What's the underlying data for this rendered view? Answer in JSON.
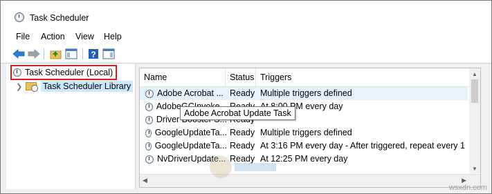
{
  "window": {
    "title": "Task Scheduler"
  },
  "menu": {
    "items": [
      "File",
      "Action",
      "View",
      "Help"
    ]
  },
  "toolbar": {
    "buttons": [
      "back-arrow-icon",
      "forward-arrow-icon",
      "up-folder-icon",
      "show-hide-console-tree-icon",
      "help-icon",
      "show-hide-action-pane-icon"
    ]
  },
  "tree": {
    "root": {
      "label": "Task Scheduler (Local)",
      "highlight_color": "#d32020"
    },
    "child": {
      "label": "Task Scheduler Library",
      "selected": true
    }
  },
  "list": {
    "columns": [
      "Name",
      "Status",
      "Triggers"
    ],
    "rows": [
      {
        "name": "Adobe Acrobat ...",
        "status": "Ready",
        "triggers": "Multiple triggers defined"
      },
      {
        "name": "AdobeGCInvoke...",
        "status": "Ready",
        "triggers": "At 8:00 PM every day"
      },
      {
        "name": "Driver Booster S...",
        "status": "Ready",
        "triggers": ""
      },
      {
        "name": "GoogleUpdateTa...",
        "status": "Ready",
        "triggers": "Multiple triggers defined"
      },
      {
        "name": "GoogleUpdateTa...",
        "status": "Ready",
        "triggers": "At 3:16 PM every day - After triggered, repeat every 1 hou"
      },
      {
        "name": "NvDriverUpdate...",
        "status": "Ready",
        "triggers": "At 12:25 PM every day"
      }
    ]
  },
  "tooltip": {
    "text": "Adobe Acrobat Update Task"
  },
  "watermark": {
    "text": "wsxdn.com"
  },
  "colors": {
    "selection": "#cce8ff",
    "hover_row": "#e5f3ff",
    "tree_highlight": "#d32020"
  }
}
